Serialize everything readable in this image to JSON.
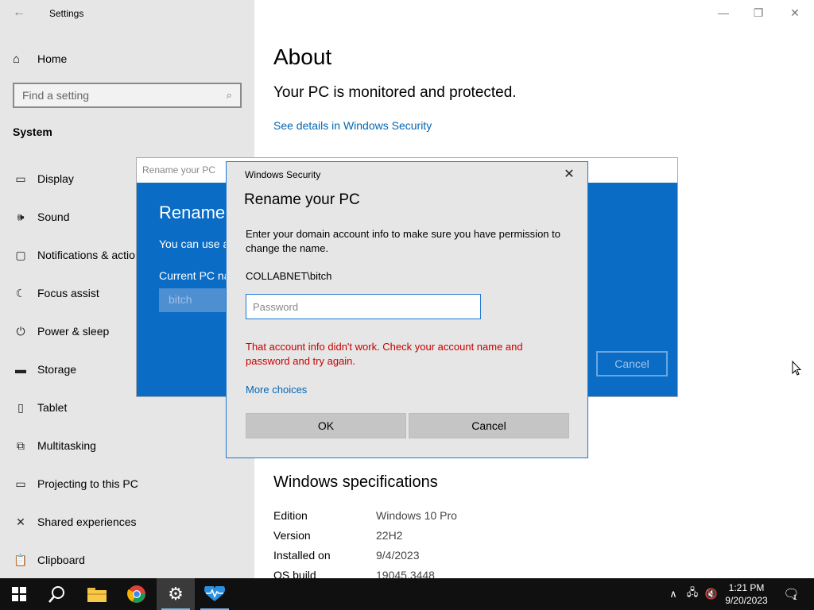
{
  "app": {
    "title": "Settings",
    "back_label": "←"
  },
  "sidebar": {
    "home_label": "Home",
    "search_placeholder": "Find a setting",
    "section": "System",
    "items": [
      {
        "label": "Display",
        "icon": "display-icon"
      },
      {
        "label": "Sound",
        "icon": "sound-icon"
      },
      {
        "label": "Notifications & actions",
        "icon": "notifications-icon"
      },
      {
        "label": "Focus assist",
        "icon": "focus-assist-icon"
      },
      {
        "label": "Power & sleep",
        "icon": "power-icon"
      },
      {
        "label": "Storage",
        "icon": "storage-icon"
      },
      {
        "label": "Tablet",
        "icon": "tablet-icon"
      },
      {
        "label": "Multitasking",
        "icon": "multitasking-icon"
      },
      {
        "label": "Projecting to this PC",
        "icon": "projecting-icon"
      },
      {
        "label": "Shared experiences",
        "icon": "shared-experiences-icon"
      },
      {
        "label": "Clipboard",
        "icon": "clipboard-icon"
      }
    ]
  },
  "main": {
    "title": "About",
    "protected_text": "Your PC is monitored and protected.",
    "security_link": "See details in Windows Security",
    "specs_title": "Windows specifications",
    "specs": [
      {
        "key": "Edition",
        "value": "Windows 10 Pro"
      },
      {
        "key": "Version",
        "value": "22H2"
      },
      {
        "key": "Installed on",
        "value": "9/4/2023"
      },
      {
        "key": "OS build",
        "value": "19045.3448"
      }
    ]
  },
  "rename_dialog": {
    "title": "Rename your PC",
    "heading": "Rename your PC",
    "subtitle": "You can use a combination of letters, hyphens, and numbers.",
    "current_label": "Current PC name: bitch",
    "input_value": "bitch",
    "cancel_label": "Cancel"
  },
  "security_dialog": {
    "window_title": "Windows Security",
    "heading": "Rename your PC",
    "description": "Enter your domain account info to make sure you have permission to change the name.",
    "username": "COLLABNET\\bitch",
    "password_placeholder": "Password",
    "error": "That account info didn't work. Check your account name and password and try again.",
    "more_choices": "More choices",
    "ok_label": "OK",
    "cancel_label": "Cancel",
    "close_glyph": "✕"
  },
  "taskbar": {
    "time": "1:21 PM",
    "date": "9/20/2023",
    "notification_count": "1",
    "accent": "#76b9ed"
  }
}
